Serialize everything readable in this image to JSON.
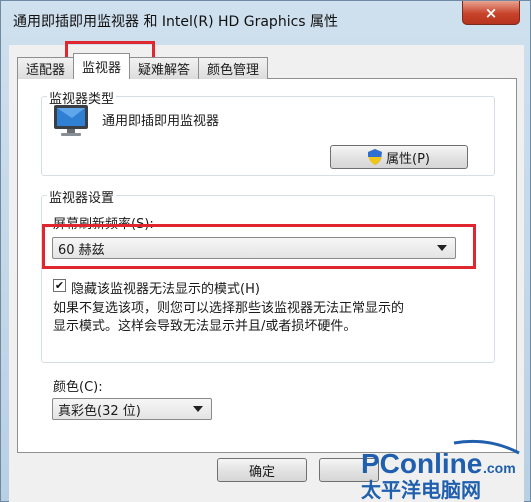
{
  "window": {
    "title": "通用即插即用监视器 和 Intel(R) HD Graphics 属性",
    "close_icon": "×"
  },
  "tabs": [
    {
      "label": "适配器"
    },
    {
      "label": "监视器"
    },
    {
      "label": "疑难解答"
    },
    {
      "label": "颜色管理"
    }
  ],
  "monitor_type": {
    "group_title": "监视器类型",
    "name": "通用即插即用监视器",
    "properties_button": "属性(P)"
  },
  "monitor_settings": {
    "group_title": "监视器设置",
    "refresh_label": "屏幕刷新频率(S):",
    "refresh_value": "60 赫兹",
    "hide_modes_label": "隐藏该监视器无法显示的模式(H)",
    "hide_modes_checked": true,
    "description": [
      "如果不复选该项，则您可以选择那些该监视器无法正常显示的",
      "显示模式。这样会导致无法显示并且/或者损坏硬件。"
    ]
  },
  "colors": {
    "label": "颜色(C):",
    "value": "真彩色(32 位)"
  },
  "footer": {
    "ok_button": "确定"
  },
  "watermark": {
    "brand": "PConline",
    "dotcom": ".com",
    "tagline": "太平洋电脑网"
  },
  "accent_colors": {
    "highlight_red": "#e0262e",
    "brand_blue": "#1f5fae"
  }
}
